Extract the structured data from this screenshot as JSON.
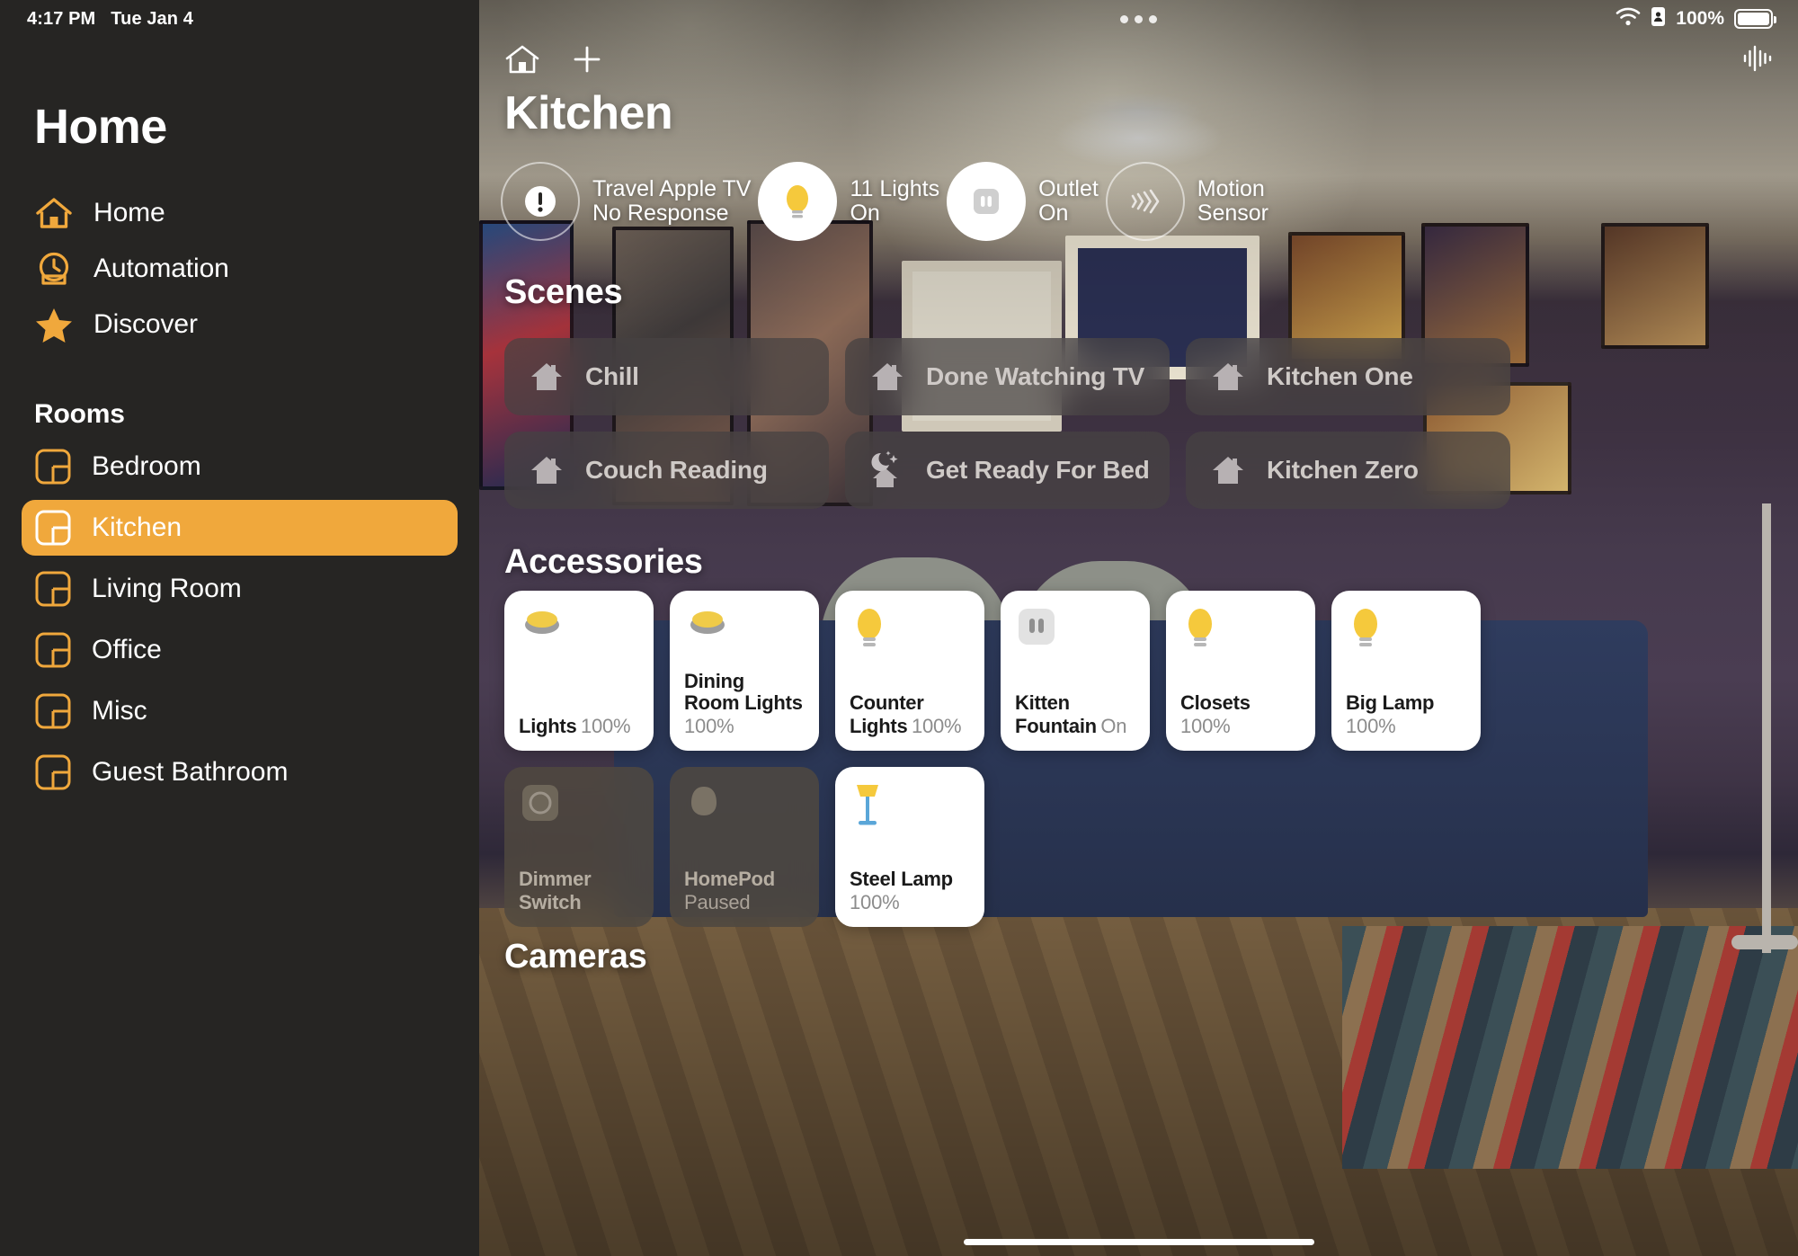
{
  "status_bar": {
    "time": "4:17 PM",
    "date": "Tue Jan 4",
    "battery_percent": "100%",
    "wifi_icon": "wifi-icon",
    "battery_icon": "battery-icon",
    "lock_icon": "portrait-lock-icon"
  },
  "sidebar": {
    "title": "Home",
    "nav": [
      {
        "label": "Home",
        "icon": "house-icon"
      },
      {
        "label": "Automation",
        "icon": "clock-icon"
      },
      {
        "label": "Discover",
        "icon": "star-icon"
      }
    ],
    "rooms_header": "Rooms",
    "rooms": [
      {
        "label": "Bedroom",
        "icon": "room-icon",
        "selected": false
      },
      {
        "label": "Kitchen",
        "icon": "room-icon",
        "selected": true
      },
      {
        "label": "Living Room",
        "icon": "room-icon",
        "selected": false
      },
      {
        "label": "Office",
        "icon": "room-icon",
        "selected": false
      },
      {
        "label": "Misc",
        "icon": "room-icon",
        "selected": false
      },
      {
        "label": "Guest Bathroom",
        "icon": "room-icon",
        "selected": false
      }
    ]
  },
  "main": {
    "header": {
      "home_icon": "house-icon",
      "add_icon": "plus-icon",
      "audio_icon": "audio-waveform-icon",
      "room_title": "Kitchen"
    },
    "status_items": [
      {
        "icon": "exclamation-icon",
        "style": "outline",
        "line1": "Travel Apple TV",
        "line2": "No Response"
      },
      {
        "icon": "lightbulb-icon",
        "style": "filled",
        "line1": "11 Lights",
        "line2": "On"
      },
      {
        "icon": "outlet-icon",
        "style": "filled",
        "line1": "Outlet",
        "line2": "On"
      },
      {
        "icon": "motion-sensor-icon",
        "style": "outline",
        "line1": "Motion",
        "line2": "Sensor"
      }
    ],
    "scenes_title": "Scenes",
    "scenes": [
      {
        "label": "Chill",
        "icon": "house-icon"
      },
      {
        "label": "Done Watching TV",
        "icon": "house-icon"
      },
      {
        "label": "Kitchen One",
        "icon": "house-icon"
      },
      {
        "label": "Couch Reading",
        "icon": "house-icon"
      },
      {
        "label": "Get Ready For Bed",
        "icon": "moon-stars-house-icon"
      },
      {
        "label": "Kitchen Zero",
        "icon": "house-icon"
      }
    ],
    "accessories_title": "Accessories",
    "accessories": [
      {
        "name": "Lights",
        "state": "100%",
        "icon": "ceiling-light-icon",
        "on": true
      },
      {
        "name": "Dining Room Lights",
        "state": "100%",
        "icon": "ceiling-light-icon",
        "on": true
      },
      {
        "name": "Counter Lights",
        "state": "100%",
        "icon": "lightbulb-icon",
        "on": true
      },
      {
        "name": "Kitten Fountain",
        "state": "On",
        "icon": "outlet-icon",
        "on": true
      },
      {
        "name": "Closets",
        "state": "100%",
        "icon": "lightbulb-icon",
        "on": true
      },
      {
        "name": "Big Lamp",
        "state": "100%",
        "icon": "lightbulb-icon",
        "on": true
      },
      {
        "name": "Dimmer Switch",
        "state": "",
        "icon": "dimmer-switch-icon",
        "on": false
      },
      {
        "name": "HomePod",
        "state": "Paused",
        "icon": "homepod-icon",
        "on": false
      },
      {
        "name": "Steel Lamp",
        "state": "100%",
        "icon": "floor-lamp-icon",
        "on": true
      }
    ],
    "cameras_title": "Cameras"
  },
  "colors": {
    "accent": "#f0a83c",
    "sidebar_bg": "#262523",
    "bulb_yellow": "#f5c93c",
    "card_white": "#ffffff"
  }
}
